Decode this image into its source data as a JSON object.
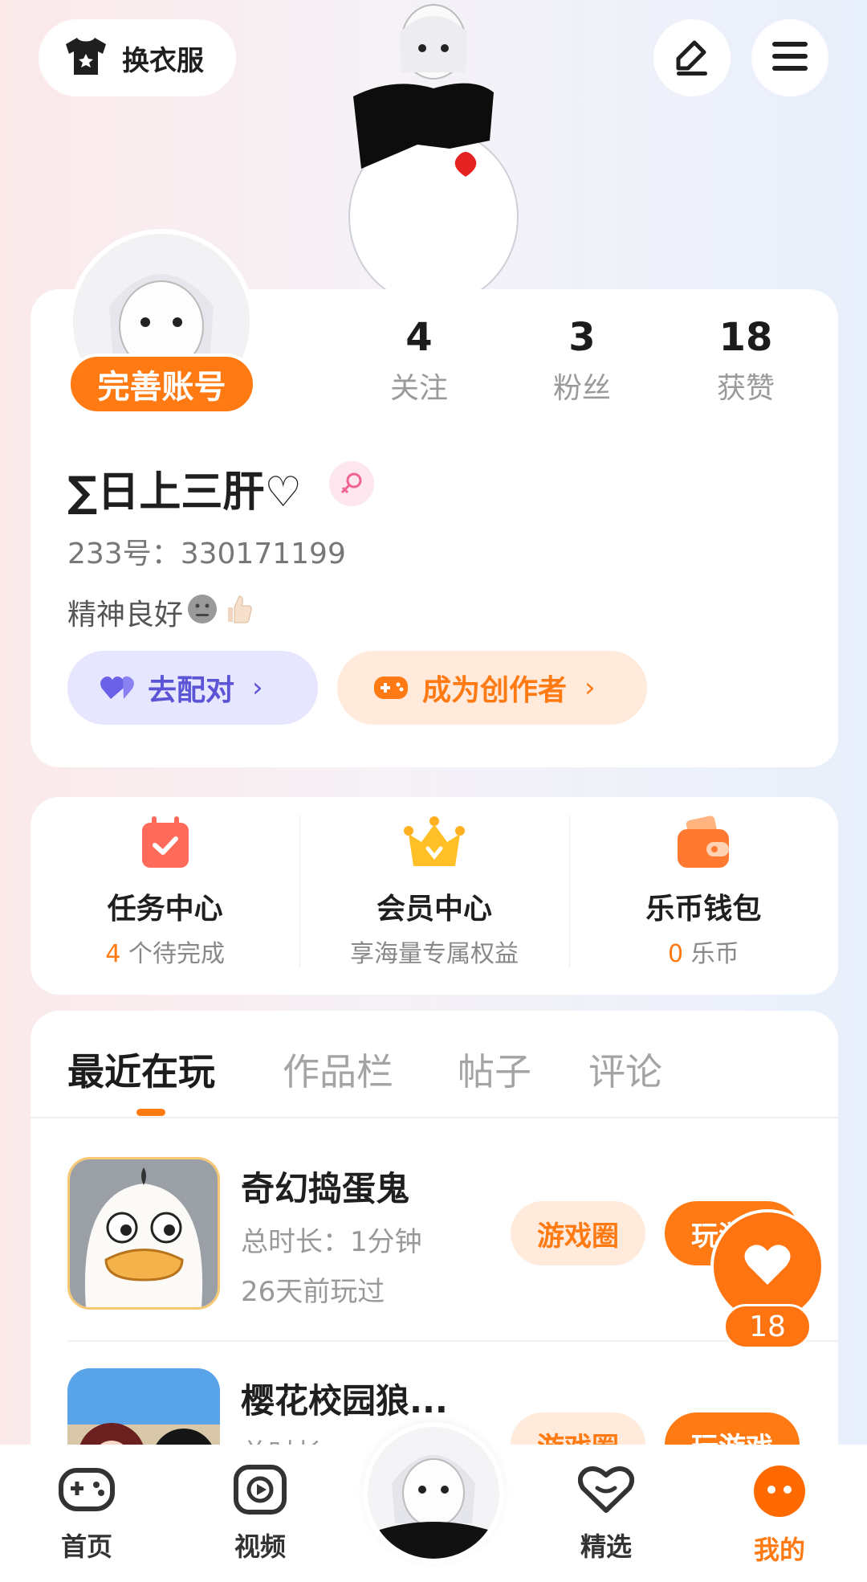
{
  "top": {
    "outfit_label": "换衣服"
  },
  "profile": {
    "complete_label": "完善账号",
    "stats": [
      {
        "num": "4",
        "label": "关注"
      },
      {
        "num": "3",
        "label": "粉丝"
      },
      {
        "num": "18",
        "label": "获赞"
      }
    ],
    "username": "∑日上三肝♡",
    "uid": "233号：330171199",
    "bio": "精神良好",
    "pair_label": "去配对",
    "creator_label": "成为创作者"
  },
  "services": [
    {
      "title": "任务中心",
      "count": "4",
      "sub": " 个待完成"
    },
    {
      "title": "会员中心",
      "sub": "享海量专属权益"
    },
    {
      "title": "乐币钱包",
      "count": "0",
      "sub": " 乐币"
    }
  ],
  "tabs": [
    "最近在玩",
    "作品栏",
    "帖子",
    "评论"
  ],
  "games": [
    {
      "title": "奇幻捣蛋鬼",
      "duration": "总时长：1分钟",
      "last": "26天前玩过",
      "circle_label": "游戏圈",
      "play_label": "玩游戏"
    },
    {
      "title": "樱花校园狼...",
      "duration": "总时长",
      "circle_label": "游戏圈",
      "play_label": "玩游戏"
    }
  ],
  "like": {
    "count": "18"
  },
  "nav": [
    {
      "label": "首页"
    },
    {
      "label": "视频"
    },
    {
      "label": "精选"
    },
    {
      "label": "我的"
    }
  ],
  "colors": {
    "accent": "#ff7a12",
    "pair": "#5b54d6"
  }
}
